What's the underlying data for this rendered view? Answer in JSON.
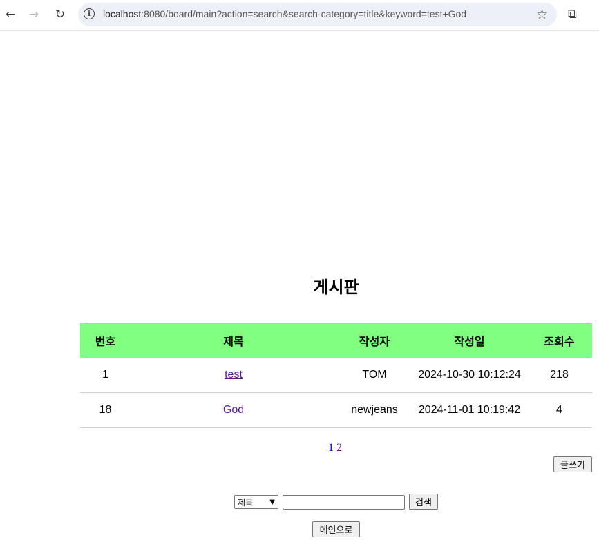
{
  "browser": {
    "url_host": "localhost",
    "url_rest": ":8080/board/main?action=search&search-category=title&keyword=test+God",
    "back_icon": "←",
    "forward_icon": "→",
    "reload_icon": "↻",
    "star_icon": "☆",
    "info_icon": "i",
    "extensions_icon": "⧉"
  },
  "page": {
    "title": "게시판"
  },
  "table": {
    "headers": {
      "no": "번호",
      "title": "제목",
      "author": "작성자",
      "date": "작성일",
      "views": "조회수"
    },
    "rows": [
      {
        "no": "1",
        "title": "test",
        "author": "TOM",
        "date": "2024-10-30 10:12:24",
        "views": "218"
      },
      {
        "no": "18",
        "title": "God",
        "author": "newjeans",
        "date": "2024-11-01 10:19:42",
        "views": "4"
      }
    ]
  },
  "pagination": {
    "pages": [
      "1",
      "2"
    ]
  },
  "buttons": {
    "write": "글쓰기",
    "search": "검색",
    "main": "메인으로"
  },
  "search": {
    "category_selected": "제목",
    "keyword_value": ""
  },
  "colors": {
    "header_bg": "#80ff80",
    "visited_link": "#551a8b"
  }
}
